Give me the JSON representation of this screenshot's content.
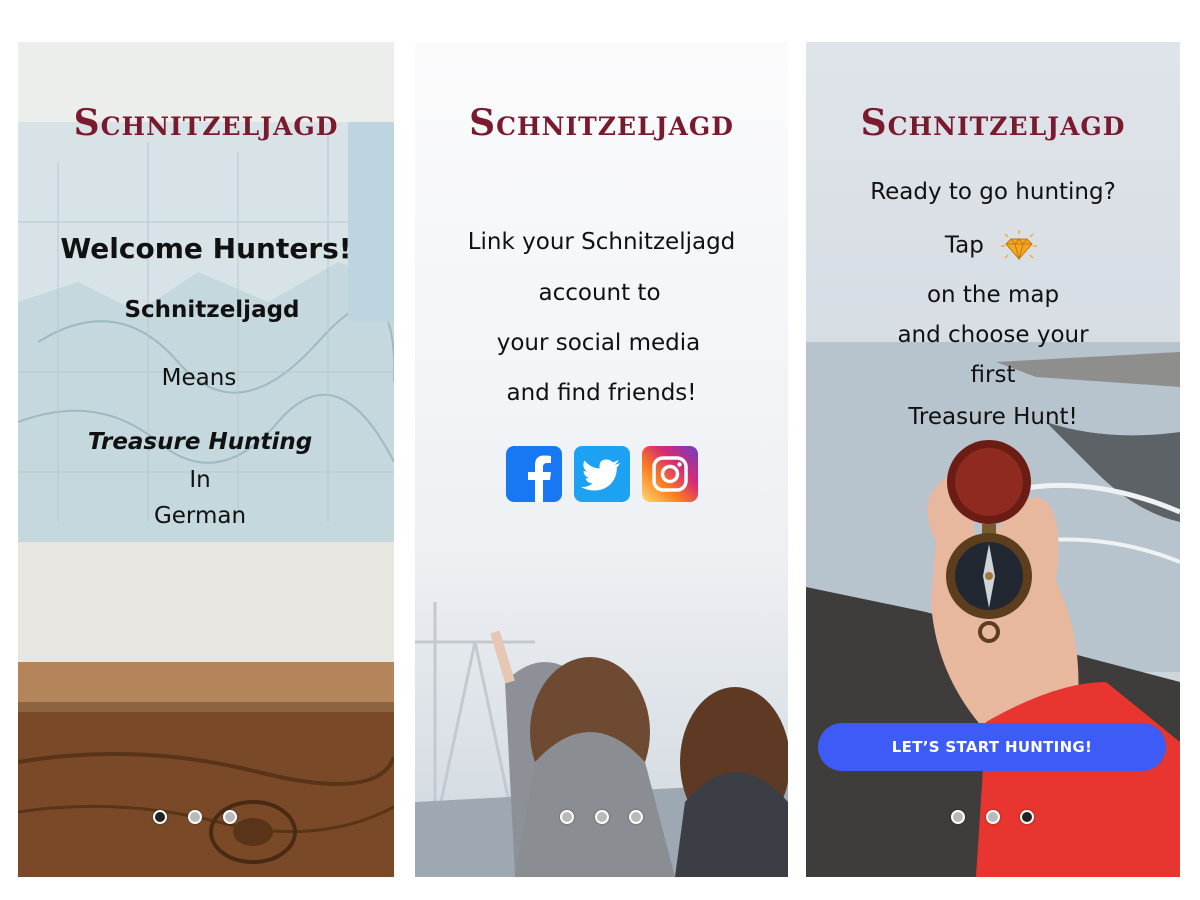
{
  "brand": {
    "title": "Schnitzeljagd",
    "color": "#7a1a2e"
  },
  "screen1": {
    "heading": "Welcome Hunters!",
    "line1": "Schnitzeljagd",
    "line2": "Means",
    "line3": "Treasure Hunting",
    "line4": "In",
    "line5": "German",
    "background": "map-on-wall-photo",
    "active_dot": 0
  },
  "screen2": {
    "line1": "Link your Schnitzeljagd",
    "line2": "account to",
    "line3": "your social media",
    "line4": "and find friends!",
    "social_icons": [
      "facebook-icon",
      "twitter-icon",
      "instagram-icon"
    ],
    "background": "friends-waving-photo",
    "active_dot": 1
  },
  "screen3": {
    "line1": "Ready to go hunting?",
    "line2": "Tap",
    "tap_icon": "gem-icon",
    "line3": "on the map",
    "line4": "and choose your",
    "line5": "first",
    "line6": "Treasure Hunt!",
    "cta_label": "LET’S START HUNTING!",
    "cta_color": "#3d5cf5",
    "background": "hand-holding-compass-photo",
    "active_dot": 2
  },
  "pager": {
    "count": 3
  }
}
